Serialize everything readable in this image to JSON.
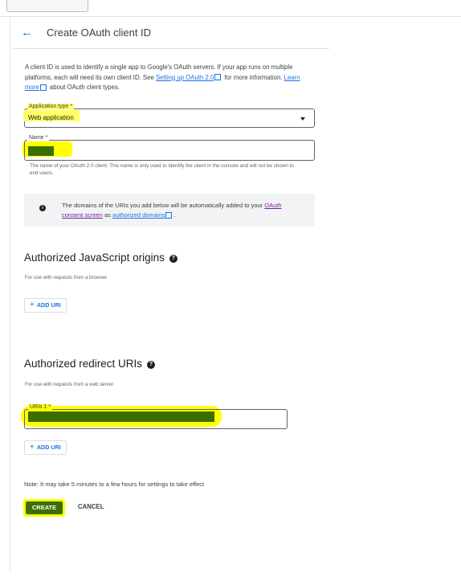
{
  "header": {
    "back_glyph": "←",
    "title": "Create OAuth client ID"
  },
  "intro": {
    "text1": "A client ID is used to identify a single app to Google's OAuth servers. If your app runs on multiple platforms, each will need its own client ID. See ",
    "link1": "Setting up OAuth 2.0",
    "text2": " for more information. ",
    "link2": "Learn more",
    "text3": " about OAuth client types."
  },
  "app_type": {
    "label": "Application type *",
    "value": "Web application"
  },
  "name_field": {
    "label": "Name *",
    "help": "The name of your OAuth 2.0 client. This name is only used to identify the client in the console and will not be shown to end users."
  },
  "info": {
    "icon": "info-icon",
    "text1": "The domains of the URIs you add below will be automatically added to your ",
    "link1": "OAuth consent screen",
    "text2": " as ",
    "link2": "authorized domains",
    "text3": "."
  },
  "js_origins": {
    "heading": "Authorized JavaScript origins",
    "help_glyph": "?",
    "subtitle": "For use with requests from a browser",
    "add_label": "ADD URI",
    "add_glyph": "+"
  },
  "redirect": {
    "heading": "Authorized redirect URIs",
    "help_glyph": "?",
    "subtitle": "For use with requests from a web server",
    "uri_label": "URIs 1 *",
    "add_label": "ADD URI",
    "add_glyph": "+"
  },
  "note": "Note: It may take 5 minutes to a few hours for settings to take effect",
  "actions": {
    "create": "CREATE",
    "cancel": "CANCEL"
  },
  "colors": {
    "accent": "#1a73e8",
    "highlight": "#ffff00",
    "redaction": "#3b6e00"
  }
}
